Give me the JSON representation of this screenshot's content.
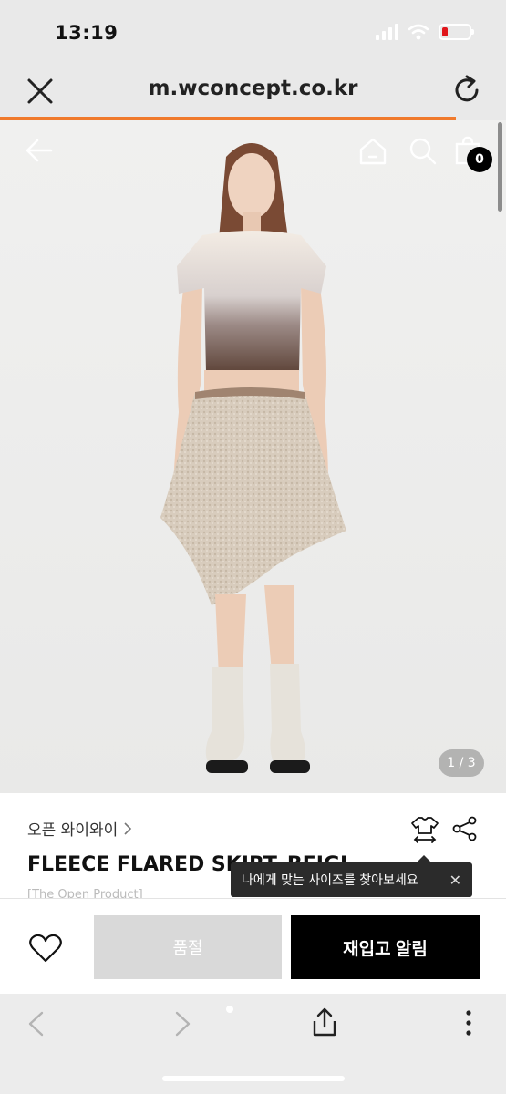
{
  "status_bar": {
    "time": "13:19"
  },
  "browser": {
    "url": "m.wconcept.co.kr",
    "load_progress": 0.9
  },
  "product": {
    "brand": "오픈 와이와이",
    "title": "FLEECE FLARED SKIRT_BEIGE",
    "sub_label": "[The Open Product]",
    "image_counter": "1 / 3",
    "cart_count": "0"
  },
  "tooltip": {
    "text": "나에게 맞는 사이즈를 찾아보세요",
    "close": "✕"
  },
  "actions": {
    "sold_out": "품절",
    "restock_alert": "재입고 알림"
  },
  "icons": {
    "close": "close-icon",
    "reload": "reload-icon",
    "back": "arrow-left-icon",
    "home": "home-icon",
    "search": "search-icon",
    "bag": "shopping-bag-icon",
    "size": "size-guide-icon",
    "share": "share-icon",
    "wish": "heart-icon",
    "more": "more-vertical-icon"
  },
  "colors": {
    "progress": "#f07a2c",
    "primary_button": "#000000",
    "disabled_button": "#d9d9d9"
  }
}
